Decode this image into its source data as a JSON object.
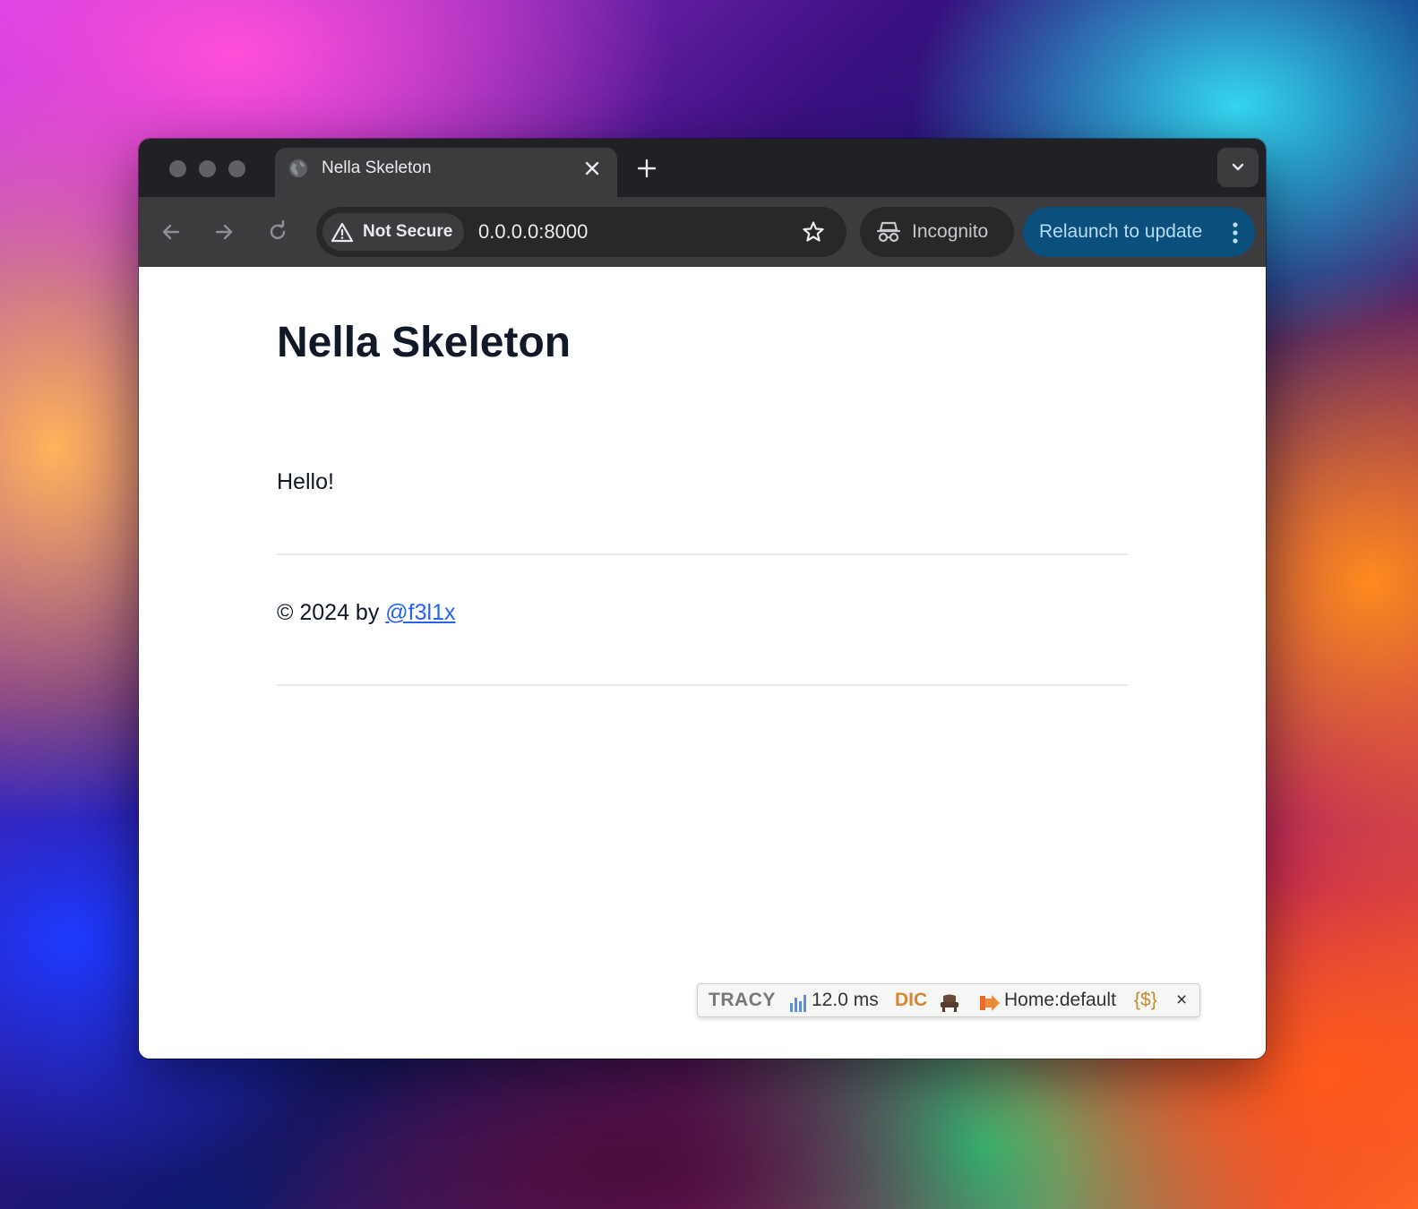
{
  "browser": {
    "tab": {
      "title": "Nella Skeleton"
    },
    "security_chip": {
      "label": "Not Secure"
    },
    "address_bar": {
      "url": "0.0.0.0:8000"
    },
    "profile": {
      "label": "Incognito"
    },
    "update_button": {
      "label": "Relaunch to update"
    }
  },
  "page": {
    "heading": "Nella Skeleton",
    "body_text": "Hello!",
    "footer": {
      "prefix": "© 2024 by ",
      "link_text": "@f3l1x"
    }
  },
  "tracy_bar": {
    "logo": "TRACY",
    "time": "12.0 ms",
    "dic_label": "DIC",
    "route": "Home:default",
    "session_label": "{$}",
    "close": "×"
  },
  "colors": {
    "tab_strip": "#202124",
    "toolbar": "#3c3c3e",
    "relaunch_bg": "#0b4f7d",
    "heading_text": "#111827",
    "link": "#2563eb"
  },
  "icons": [
    "globe-icon",
    "close-icon",
    "plus-icon",
    "chevron-down-icon",
    "back-arrow-icon",
    "forward-arrow-icon",
    "reload-icon",
    "warning-icon",
    "star-icon",
    "incognito-icon",
    "more-vert-icon",
    "bar-chart-icon",
    "chair-icon",
    "route-arrow-icon"
  ]
}
